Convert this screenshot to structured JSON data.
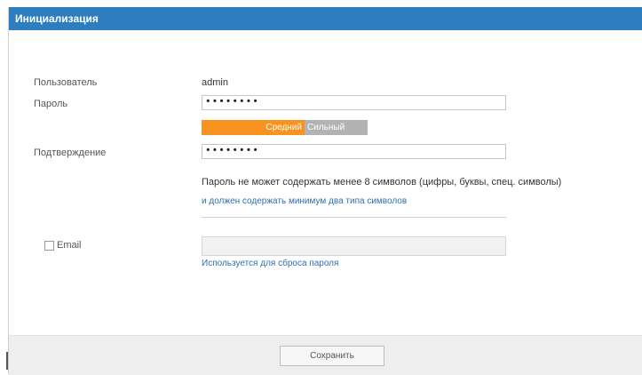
{
  "dialog": {
    "title": "Инициализация"
  },
  "form": {
    "user_label": "Пользователь",
    "user_value": "admin",
    "password_label": "Пароль",
    "password_value": "••••••••",
    "strength_medium": "Средний",
    "strength_strong": "Сильный",
    "confirm_label": "Подтверждение",
    "confirm_value": "••••••••",
    "password_hint": "Пароль не может содержать менее 8 символов (цифры, буквы, спец. символы)",
    "password_hint2": "и должен содержать минимум два типа символов",
    "email_label": "Email",
    "email_value": "",
    "email_hint": "Используется для сброса пароля"
  },
  "footer": {
    "save_label": "Сохранить"
  },
  "colors": {
    "titlebar": "#2d7ec1",
    "strength_medium": "#f7931e",
    "strength_inactive": "#b3b3b3"
  }
}
